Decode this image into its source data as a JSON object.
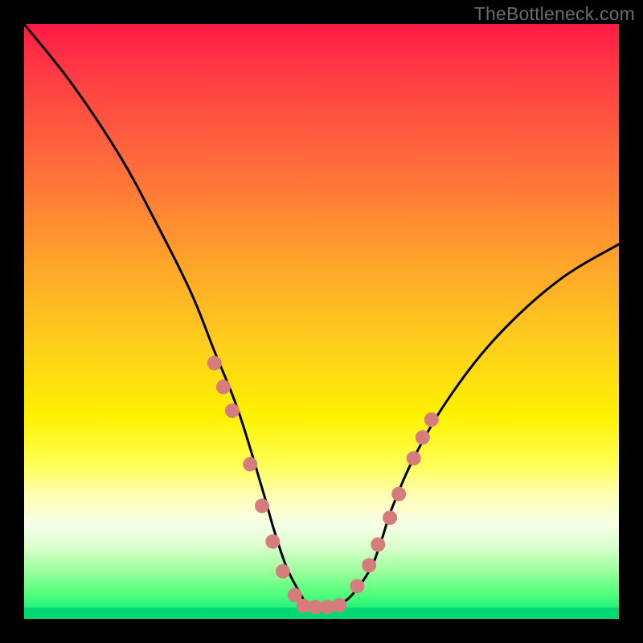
{
  "watermark": "TheBottleneck.com",
  "chart_data": {
    "type": "line",
    "title": "",
    "xlabel": "",
    "ylabel": "",
    "xlim": [
      0,
      100
    ],
    "ylim": [
      0,
      100
    ],
    "series": [
      {
        "name": "bottleneck-curve",
        "x": [
          0,
          8,
          16,
          22,
          28,
          32,
          36,
          40,
          42,
          44,
          46,
          48,
          50,
          54,
          58,
          60,
          62,
          66,
          72,
          80,
          90,
          100
        ],
        "values": [
          100,
          90,
          78,
          67,
          55,
          45,
          35,
          22,
          15,
          9,
          5,
          2,
          2,
          3,
          8,
          13,
          19,
          28,
          38,
          48,
          57,
          63
        ]
      }
    ],
    "markers_left": {
      "name": "left-dense-dots",
      "x": [
        32.0,
        33.5,
        35.0,
        38.0,
        40.0,
        41.8,
        43.5,
        45.5
      ],
      "values": [
        43.0,
        39.0,
        35.0,
        26.0,
        19.0,
        13.0,
        8.0,
        4.0
      ]
    },
    "markers_bottom": {
      "name": "bottom-flat-dots",
      "x": [
        47.0,
        49.0,
        51.0,
        53.0
      ],
      "values": [
        2.2,
        2.0,
        2.0,
        2.3
      ]
    },
    "markers_right": {
      "name": "right-dense-dots",
      "x": [
        56.0,
        58.0,
        59.5,
        61.5,
        63.0,
        65.5,
        67.0,
        68.5
      ],
      "values": [
        5.5,
        9.0,
        12.5,
        17.0,
        21.0,
        27.0,
        30.5,
        33.5
      ]
    },
    "marker_color": "#d77c7c",
    "curve_color": "#000000",
    "background_gradient": {
      "top": "#ff1a44",
      "bottom": "#00d873"
    }
  }
}
